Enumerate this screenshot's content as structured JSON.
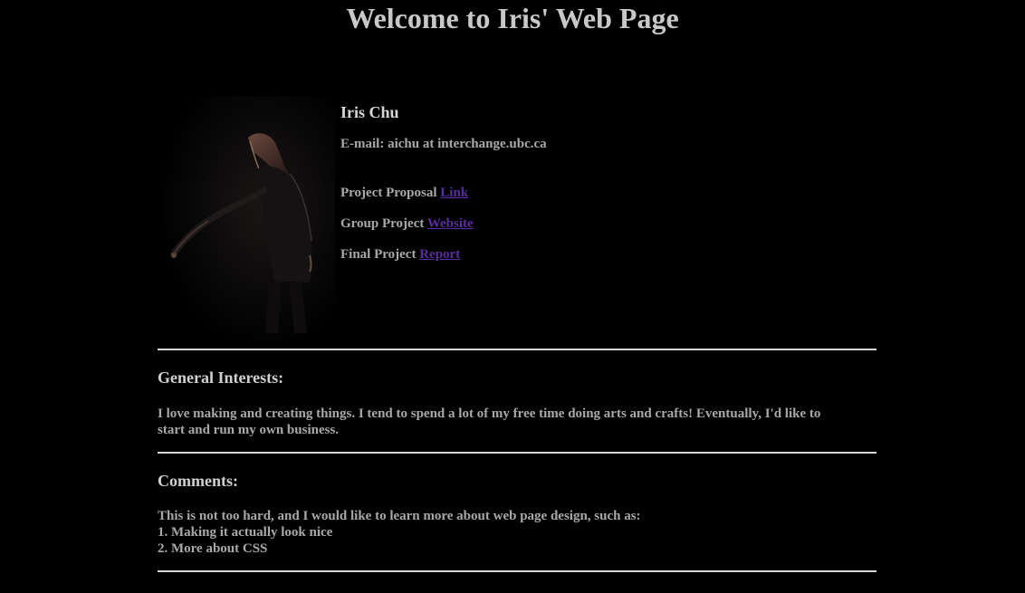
{
  "page": {
    "title": "Welcome to Iris' Web Page"
  },
  "profile": {
    "name": "Iris Chu",
    "email": "E-mail: aichu at interchange.ubc.ca",
    "links": [
      {
        "label": "Project Proposal",
        "link_text": "Link"
      },
      {
        "label": "Group Project",
        "link_text": "Website"
      },
      {
        "label": "Final Project",
        "link_text": "Report"
      }
    ],
    "link_color": "#5a2d9a"
  },
  "interests": {
    "heading": "General Interests:",
    "lines": [
      "I love making and creating things. I tend to spend a lot of my free time doing arts and crafts! Eventually, I'd like to",
      "start and run my own business."
    ]
  },
  "comments": {
    "heading": "Comments:",
    "lines": [
      "This is not too hard, and I would like to learn more about web page design, such as:",
      "1. Making it actually look nice",
      "2. More about CSS"
    ]
  }
}
